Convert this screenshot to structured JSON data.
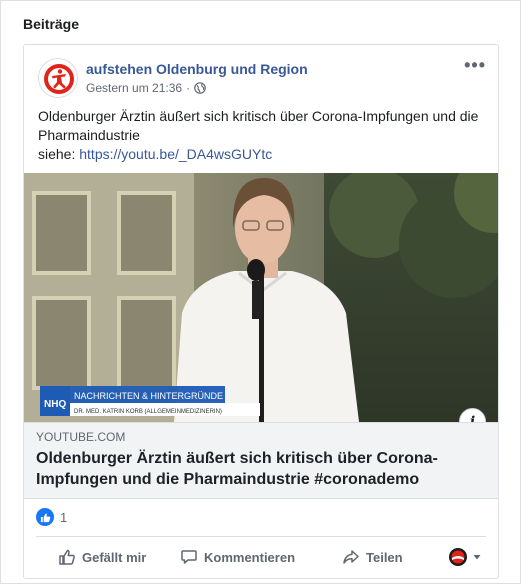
{
  "section": {
    "title": "Beiträge"
  },
  "post": {
    "page_name": "aufstehen Oldenburg und Region",
    "timestamp": "Gestern um 21:36",
    "separator": "·",
    "more_label": "•••",
    "text_line1": "Oldenburger Ärztin äußert sich kritisch über Corona-Impfungen und die Pharmaindustrie",
    "text_prefix": "siehe: ",
    "text_link": "https://youtu.be/_DA4wsGUYtc"
  },
  "media": {
    "lower_third_brand": "NHQ",
    "lower_third_title": "NACHRICHTEN & HINTERGRÜNDE",
    "lower_third_subtitle": "DR. MED. KATRIN KORB (ALLGEMEINMEDIZINERIN)",
    "info_label": "i"
  },
  "link_preview": {
    "domain": "YOUTUBE.COM",
    "title": "Oldenburger Ärztin äußert sich kritisch über Corona-Impfungen und die Pharmaindustrie #coronademo"
  },
  "reactions": {
    "count": "1"
  },
  "actions": {
    "like": "Gefällt mir",
    "comment": "Kommentieren",
    "share": "Teilen"
  },
  "colors": {
    "link": "#385898",
    "like_blue": "#1877f2",
    "nhq_blue": "#1d5bb5"
  }
}
